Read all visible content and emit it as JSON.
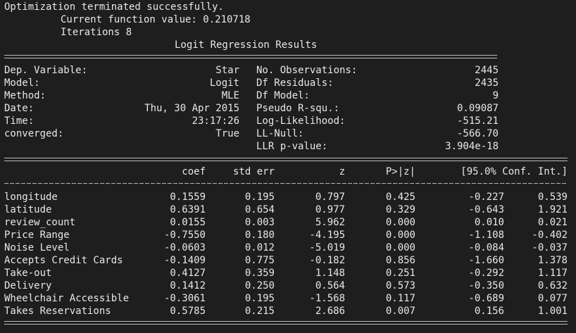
{
  "console": {
    "line1": "Optimization terminated successfully.",
    "line2": "Current function value: 0.210718",
    "line3": "Iterations 8",
    "title": "Logit Regression Results"
  },
  "summary": {
    "left": [
      {
        "label": "Dep. Variable:",
        "value": "Star"
      },
      {
        "label": "Model:",
        "value": "Logit"
      },
      {
        "label": "Method:",
        "value": "MLE"
      },
      {
        "label": "Date:",
        "value": "Thu, 30 Apr 2015"
      },
      {
        "label": "Time:",
        "value": "23:17:26"
      },
      {
        "label": "converged:",
        "value": "True"
      }
    ],
    "right": [
      {
        "label": "No. Observations:",
        "value": "2445"
      },
      {
        "label": "Df Residuals:",
        "value": "2435"
      },
      {
        "label": "Df Model:",
        "value": "9"
      },
      {
        "label": "Pseudo R-squ.:",
        "value": "0.09087"
      },
      {
        "label": "Log-Likelihood:",
        "value": "-515.21"
      },
      {
        "label": "LL-Null:",
        "value": "-566.70"
      },
      {
        "label": "LLR p-value:",
        "value": "3.904e-18"
      }
    ]
  },
  "table": {
    "headers": {
      "coef": "coef",
      "std_err": "std err",
      "z": "z",
      "p": "P>|z|",
      "ci": "[95.0% Conf. Int.]"
    },
    "rows": [
      {
        "name": "longitude",
        "coef": "0.1559",
        "std_err": "0.195",
        "z": "0.797",
        "p": "0.425",
        "lo": "-0.227",
        "hi": "0.539"
      },
      {
        "name": "latitude",
        "coef": "0.6391",
        "std_err": "0.654",
        "z": "0.977",
        "p": "0.329",
        "lo": "-0.643",
        "hi": "1.921"
      },
      {
        "name": "review_count",
        "coef": "0.0155",
        "std_err": "0.003",
        "z": "5.962",
        "p": "0.000",
        "lo": "0.010",
        "hi": "0.021"
      },
      {
        "name": "Price Range",
        "coef": "-0.7550",
        "std_err": "0.180",
        "z": "-4.195",
        "p": "0.000",
        "lo": "-1.108",
        "hi": "-0.402"
      },
      {
        "name": "Noise Level",
        "coef": "-0.0603",
        "std_err": "0.012",
        "z": "-5.019",
        "p": "0.000",
        "lo": "-0.084",
        "hi": "-0.037"
      },
      {
        "name": "Accepts Credit Cards",
        "coef": "-0.1409",
        "std_err": "0.775",
        "z": "-0.182",
        "p": "0.856",
        "lo": "-1.660",
        "hi": "1.378"
      },
      {
        "name": "Take-out",
        "coef": "0.4127",
        "std_err": "0.359",
        "z": "1.148",
        "p": "0.251",
        "lo": "-0.292",
        "hi": "1.117"
      },
      {
        "name": "Delivery",
        "coef": "0.1412",
        "std_err": "0.250",
        "z": "0.564",
        "p": "0.573",
        "lo": "-0.350",
        "hi": "0.632"
      },
      {
        "name": "Wheelchair Accessible",
        "coef": "-0.3061",
        "std_err": "0.195",
        "z": "-1.568",
        "p": "0.117",
        "lo": "-0.689",
        "hi": "0.077"
      },
      {
        "name": "Takes Reservations",
        "coef": "0.5785",
        "std_err": "0.215",
        "z": "2.686",
        "p": "0.007",
        "lo": "0.156",
        "hi": "1.001"
      }
    ]
  }
}
